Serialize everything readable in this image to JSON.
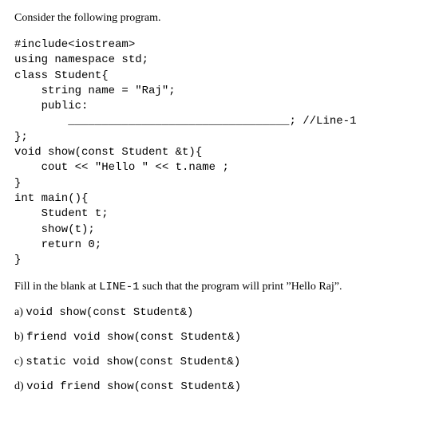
{
  "intro": "Consider the following program.",
  "code": "#include<iostream>\nusing namespace std;\nclass Student{\n    string name = \"Raj\";\n    public:\n        _________________________________; //Line-1\n};\nvoid show(const Student &t){\n    cout << \"Hello \" << t.name ;\n}\nint main(){\n    Student t;\n    show(t);\n    return 0;\n}",
  "question_prefix": "Fill in the blank at ",
  "question_line_label": "LINE-1",
  "question_middle": " such that the program will print ",
  "question_output": "”Hello Raj”",
  "question_suffix": ".",
  "options": [
    {
      "label": "a) ",
      "code": "void show(const Student&)"
    },
    {
      "label": "b) ",
      "code": "friend void show(const Student&)"
    },
    {
      "label": "c) ",
      "code": "static void show(const Student&)"
    },
    {
      "label": "d) ",
      "code": "void friend show(const Student&)"
    }
  ]
}
